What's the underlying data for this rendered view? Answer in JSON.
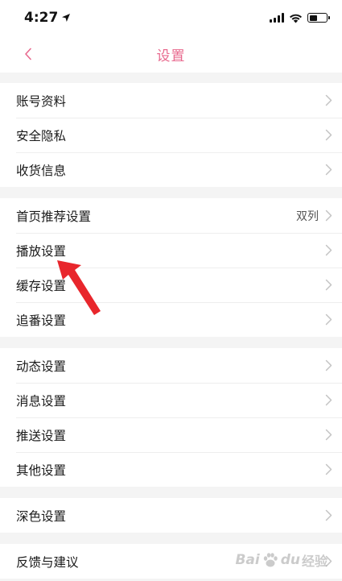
{
  "status_bar": {
    "time": "4:27"
  },
  "nav": {
    "title": "设置"
  },
  "groups": [
    {
      "items": [
        {
          "label": "账号资料"
        },
        {
          "label": "安全隐私"
        },
        {
          "label": "收货信息"
        }
      ]
    },
    {
      "items": [
        {
          "label": "首页推荐设置",
          "value": "双列"
        },
        {
          "label": "播放设置"
        },
        {
          "label": "缓存设置"
        },
        {
          "label": "追番设置"
        }
      ]
    },
    {
      "items": [
        {
          "label": "动态设置"
        },
        {
          "label": "消息设置"
        },
        {
          "label": "推送设置"
        },
        {
          "label": "其他设置"
        }
      ]
    },
    {
      "items": [
        {
          "label": "深色设置"
        }
      ]
    },
    {
      "items": [
        {
          "label": "反馈与建议"
        }
      ]
    }
  ],
  "watermark": {
    "brand": "Bai",
    "brand_end": "du",
    "sub": "经验"
  },
  "colors": {
    "accent": "#e8698e",
    "annotation": "#e8262c",
    "background": "#f4f4f4"
  }
}
